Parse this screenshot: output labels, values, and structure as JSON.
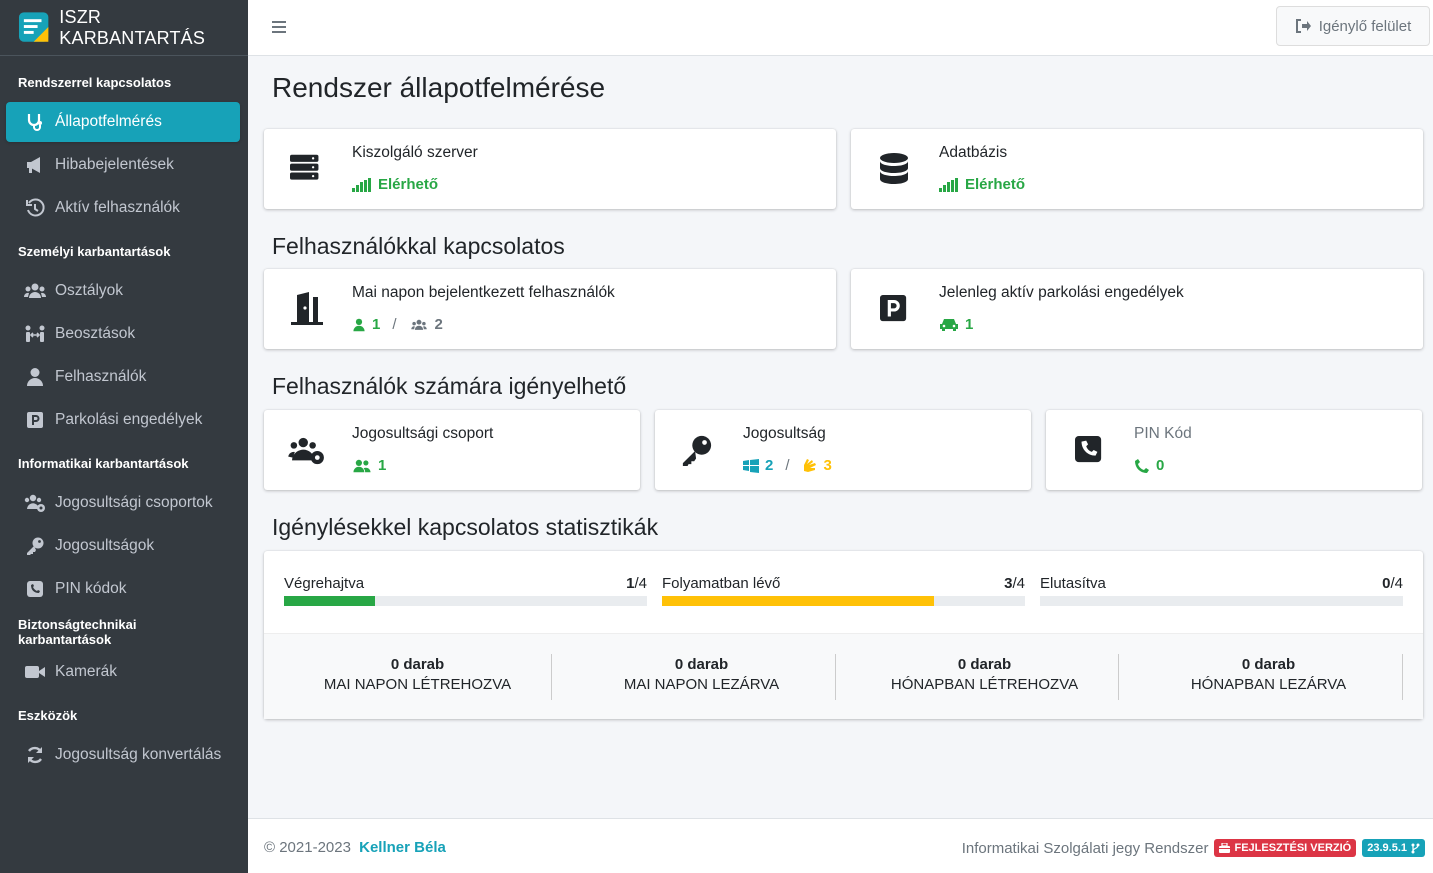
{
  "brand": {
    "title": "ISZR KARBANTARTÁS"
  },
  "sidebar": {
    "sections": [
      {
        "header": "Rendszerrel kapcsolatos",
        "items": [
          {
            "label": "Állapotfelmérés",
            "icon": "stethoscope-icon"
          },
          {
            "label": "Hibabejelentések",
            "icon": "bullhorn-icon"
          },
          {
            "label": "Aktív felhasználók",
            "icon": "history-icon"
          }
        ]
      },
      {
        "header": "Személyi karbantartások",
        "items": [
          {
            "label": "Osztályok",
            "icon": "users-icon"
          },
          {
            "label": "Beosztások",
            "icon": "people-arrows-icon"
          },
          {
            "label": "Felhasználók",
            "icon": "user-icon"
          },
          {
            "label": "Parkolási engedélyek",
            "icon": "parking-icon"
          }
        ]
      },
      {
        "header": "Informatikai karbantartások",
        "items": [
          {
            "label": "Jogosultsági csoportok",
            "icon": "users-cog-icon"
          },
          {
            "label": "Jogosultságok",
            "icon": "key-icon"
          },
          {
            "label": "PIN kódok",
            "icon": "phone-square-icon"
          }
        ]
      },
      {
        "header": "Biztonságtechnikai karbantartások",
        "items": [
          {
            "label": "Kamerák",
            "icon": "video-icon"
          }
        ]
      },
      {
        "header": "Eszközök",
        "items": [
          {
            "label": "Jogosultság konvertálás",
            "icon": "sync-icon"
          }
        ]
      }
    ]
  },
  "topbar": {
    "requester_button": "Igénylő felület"
  },
  "page": {
    "title": "Rendszer állapotfelmérése"
  },
  "system": {
    "server": {
      "label": "Kiszolgáló szerver",
      "status": "Elérhető"
    },
    "database": {
      "label": "Adatbázis",
      "status": "Elérhető"
    }
  },
  "users_section": {
    "title": "Felhasználókkal kapcsolatos",
    "logged_in": {
      "label": "Mai napon bejelentkezett felhasználók",
      "single": "1",
      "sep": "/",
      "group": "2"
    },
    "parking": {
      "label": "Jelenleg aktív parkolási engedélyek",
      "value": "1"
    }
  },
  "requestable_section": {
    "title": "Felhasználók számára igényelhető",
    "group": {
      "label": "Jogosultsági csoport",
      "value": "1"
    },
    "permission": {
      "label": "Jogosultság",
      "windows": "2",
      "sep": "/",
      "other": "3"
    },
    "pin": {
      "label": "PIN Kód",
      "value": "0"
    }
  },
  "stats_section": {
    "title": "Igénylésekkel kapcsolatos statisztikák",
    "progress": [
      {
        "label": "Végrehajtva",
        "value": "1",
        "total": "/4",
        "fraction": 0.25,
        "color": "#28a745"
      },
      {
        "label": "Folyamatban lévő",
        "value": "3",
        "total": "/4",
        "fraction": 0.75,
        "color": "#ffc107"
      },
      {
        "label": "Elutasítva",
        "value": "0",
        "total": "/4",
        "fraction": 0,
        "color": "#dc3545"
      }
    ],
    "counters": [
      {
        "value": "0 darab",
        "label": "MAI NAPON LÉTREHOZVA"
      },
      {
        "value": "0 darab",
        "label": "MAI NAPON LEZÁRVA"
      },
      {
        "value": "0 darab",
        "label": "HÓNAPBAN LÉTREHOZVA"
      },
      {
        "value": "0 darab",
        "label": "HÓNAPBAN LEZÁRVA"
      }
    ]
  },
  "footer": {
    "copyright": "© 2021-2023",
    "author": "Kellner Béla",
    "system_name": "Informatikai Szolgálati jegy Rendszer",
    "dev_badge": "FEJLESZTÉSI VERZIÓ",
    "version": "23.9.5.1"
  },
  "colors": {
    "accent": "#17a2b8",
    "success": "#28a745",
    "warning": "#ffc107",
    "danger": "#dc3545",
    "sidebar": "#343a40"
  }
}
